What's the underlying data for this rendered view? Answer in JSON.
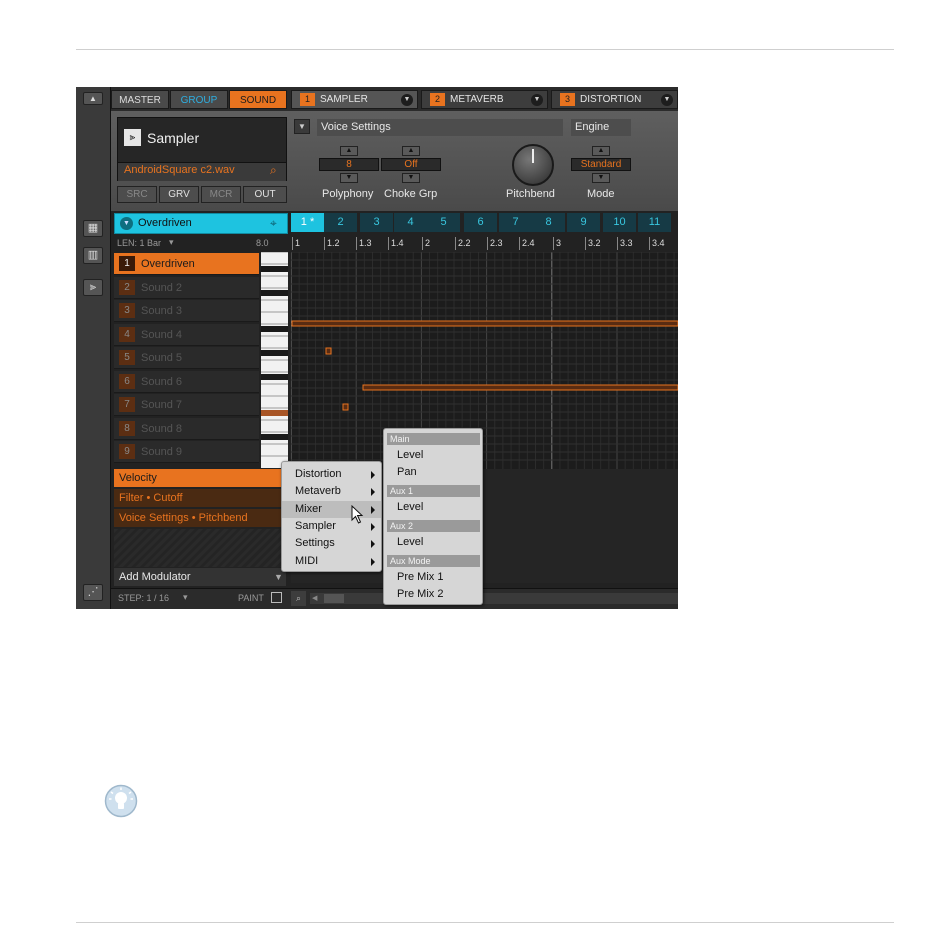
{
  "top_tabs": {
    "master": "MASTER",
    "group": "GROUP",
    "sound": "SOUND"
  },
  "plugin_slots": [
    {
      "num": "1",
      "name": "SAMPLER"
    },
    {
      "num": "2",
      "name": "METAVERB"
    },
    {
      "num": "3",
      "name": "DISTORTION"
    }
  ],
  "sampler": {
    "title": "Sampler",
    "file": "AndroidSquare c2.wav",
    "tabs": [
      "SRC",
      "GRV",
      "MCR",
      "OUT"
    ]
  },
  "params": {
    "page": "Voice Settings",
    "section": "Engine",
    "polyphony_value": "8",
    "polyphony_label": "Polyphony",
    "choke_value": "Off",
    "choke_label": "Choke Grp",
    "pitchbend_label": "Pitchbend",
    "mode_value": "Standard",
    "mode_label": "Mode"
  },
  "pattern": {
    "name": "Overdriven",
    "length": "LEN: 1 Bar",
    "length_value": "8.0",
    "tabs": [
      "1 *",
      "2",
      "3",
      "4",
      "5",
      "6",
      "7",
      "8",
      "9",
      "10",
      "11"
    ],
    "ruler": [
      "1",
      "1.2",
      "1.3",
      "1.4",
      "2",
      "2.2",
      "2.3",
      "2.4",
      "3",
      "3.2",
      "3.3",
      "3.4"
    ]
  },
  "sounds": [
    {
      "n": "1",
      "name": "Overdriven"
    },
    {
      "n": "2",
      "name": "Sound 2"
    },
    {
      "n": "3",
      "name": "Sound 3"
    },
    {
      "n": "4",
      "name": "Sound 4"
    },
    {
      "n": "5",
      "name": "Sound 5"
    },
    {
      "n": "6",
      "name": "Sound 6"
    },
    {
      "n": "7",
      "name": "Sound 7"
    },
    {
      "n": "8",
      "name": "Sound 8"
    },
    {
      "n": "9",
      "name": "Sound 9"
    }
  ],
  "modulation": {
    "velocity": "Velocity",
    "filter": "Filter • Cutoff",
    "voice": "Voice Settings • Pitchbend",
    "add": "Add Modulator"
  },
  "footer": {
    "step": "STEP: 1 / 16",
    "paint": "PAINT"
  },
  "menu": {
    "items": [
      "Distortion",
      "Metaverb",
      "Mixer",
      "Sampler",
      "Settings",
      "MIDI"
    ]
  },
  "submenu": {
    "main": "Main",
    "main_level": "Level",
    "main_pan": "Pan",
    "aux1": "Aux 1",
    "aux1_level": "Level",
    "aux2": "Aux 2",
    "aux2_level": "Level",
    "auxmode": "Aux Mode",
    "pre1": "Pre Mix 1",
    "pre2": "Pre Mix 2"
  },
  "colors": {
    "accent": "#e8731f",
    "cyan": "#1ec3e0",
    "group": "#2eaee0"
  }
}
